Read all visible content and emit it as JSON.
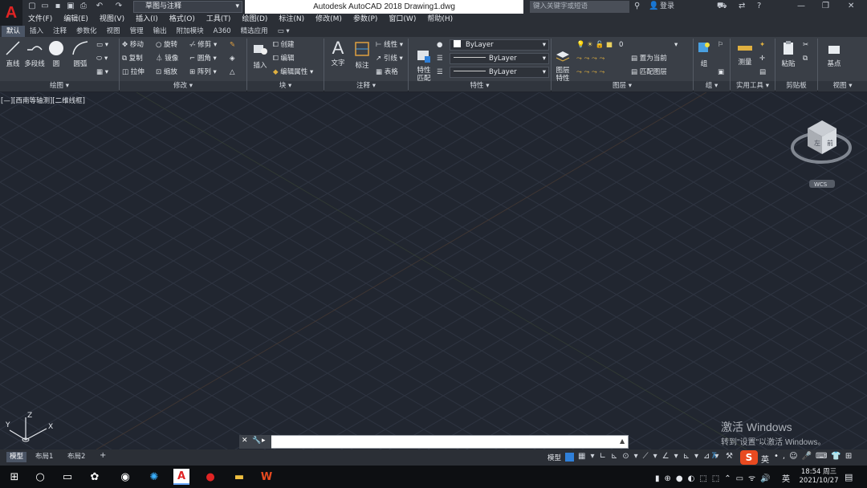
{
  "app": {
    "logo": "A",
    "title": "Autodesk AutoCAD 2018    Drawing1.dwg"
  },
  "workspace": {
    "value": "草图与注释"
  },
  "search": {
    "placeholder": "键入关键字或短语"
  },
  "login": {
    "label": "登录"
  },
  "menus": [
    "文件(F)",
    "编辑(E)",
    "视图(V)",
    "插入(I)",
    "格式(O)",
    "工具(T)",
    "绘图(D)",
    "标注(N)",
    "修改(M)",
    "参数(P)",
    "窗口(W)",
    "帮助(H)"
  ],
  "tabs": [
    "默认",
    "插入",
    "注释",
    "参数化",
    "视图",
    "管理",
    "输出",
    "附加模块",
    "A360",
    "精选应用"
  ],
  "draw": {
    "line": "直线",
    "polyline": "多段线",
    "circle": "圆",
    "arc": "圆弧",
    "panel": "绘图 ▾"
  },
  "modify": {
    "move": "移动",
    "rotate": "旋转",
    "trim": "修剪",
    "copy": "复制",
    "mirror": "镜像",
    "fillet": "圆角",
    "stretch": "拉伸",
    "scale": "缩放",
    "array": "阵列",
    "panel": "修改 ▾"
  },
  "block": {
    "insert": "插入",
    "create": "创建",
    "edit": "编辑",
    "edit_attr": "编辑属性 ▾",
    "panel": "块 ▾"
  },
  "annotation": {
    "text": "文字",
    "dim": "标注",
    "linear": "线性 ▾",
    "leader": "引线 ▾",
    "table": "表格",
    "panel": "注释 ▾"
  },
  "properties": {
    "match": "特性\n匹配",
    "color": "ByLayer",
    "linetype": "ByLayer",
    "lineweight": "ByLayer",
    "panel": "特性 ▾"
  },
  "layers": {
    "props": "图层\n特性",
    "current_layer": "0",
    "make_current": "置为当前",
    "match_layer": "匹配图层",
    "panel": "图层 ▾"
  },
  "groups": {
    "group": "组",
    "panel": "组 ▾"
  },
  "utilities": {
    "measure": "测量",
    "panel": "实用工具 ▾"
  },
  "clipboard": {
    "paste": "粘贴",
    "panel": "剪贴板"
  },
  "view": {
    "base": "基点",
    "panel": "视图 ▾"
  },
  "viewport": {
    "label": "[—][西南等轴测][二维线框]",
    "wcs": "WCS",
    "cube_left": "左",
    "cube_front": "前",
    "cube_top": "上"
  },
  "ucs": {
    "x": "X",
    "y": "Y",
    "z": "Z"
  },
  "layout_tabs": [
    "模型",
    "布局1",
    "布局2"
  ],
  "status": {
    "model": "模型"
  },
  "watermark": {
    "title": "激活 Windows",
    "subtitle": "转到\"设置\"以激活 Windows。"
  },
  "clock": {
    "time": "18:54 周三",
    "date": "2021/10/27"
  },
  "ime": {
    "lang": "英"
  },
  "colors": {
    "accent": "#2f7fd8",
    "canvas": "#212630",
    "ribbon": "#3a3f47",
    "logo": "#e02424"
  }
}
